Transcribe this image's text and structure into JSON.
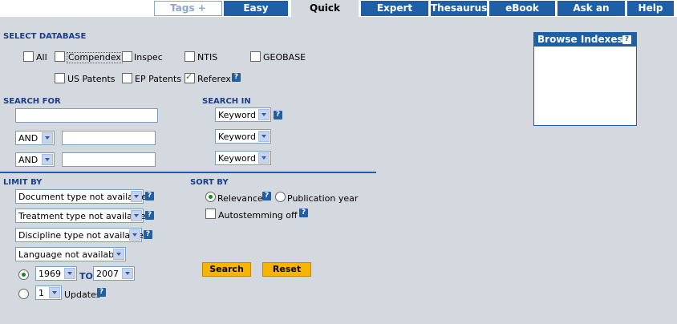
{
  "tabs": {
    "tags_groups": "Tags + Groups",
    "easy_search": "Easy Search",
    "quick_search": "Quick Search",
    "expert_search": "Expert Search",
    "thesaurus": "Thesaurus",
    "ebook_search": "eBook Search",
    "ask_expert": "Ask an Expert",
    "help": "Help"
  },
  "select_database": {
    "heading": "SELECT DATABASE",
    "options": {
      "all": {
        "label": "All",
        "checked": false
      },
      "compendex": {
        "label": "Compendex",
        "checked": false
      },
      "inspec": {
        "label": "Inspec",
        "checked": false
      },
      "ntis": {
        "label": "NTIS",
        "checked": false
      },
      "geobase": {
        "label": "GEOBASE",
        "checked": false
      },
      "us_patents": {
        "label": "US Patents",
        "checked": false
      },
      "ep_patents": {
        "label": "EP Patents",
        "checked": false
      },
      "referex": {
        "label": "Referex",
        "checked": true
      }
    }
  },
  "search_for": {
    "heading": "SEARCH FOR",
    "row1_value": "",
    "row2_operator": "AND",
    "row2_value": "",
    "row3_operator": "AND",
    "row3_value": ""
  },
  "search_in": {
    "heading": "SEARCH IN",
    "row1": "Keyword",
    "row2": "Keyword",
    "row3": "Keyword"
  },
  "limit_by": {
    "heading": "LIMIT BY",
    "document_type": "Document type not available",
    "treatment_type": "Treatment type not available",
    "discipline_type": "Discipline type not available",
    "language": "Language not available",
    "year_from": "1969",
    "to_label": "TO",
    "year_to": "2007",
    "updates_value": "1",
    "updates_label": "Updates",
    "date_range_selected": true
  },
  "sort_by": {
    "heading": "SORT BY",
    "relevance": "Relevance",
    "publication_year": "Publication year",
    "selected": "relevance",
    "autostemming_label": "Autostemming off",
    "autostemming_checked": false
  },
  "buttons": {
    "search": "Search",
    "reset": "Reset"
  },
  "browse_indexes": {
    "title": "Browse Indexes"
  },
  "icons": {
    "help": "?"
  },
  "colors": {
    "tab_blue": "#1f5fa6",
    "panel_bg": "#d4d8df",
    "heading_blue": "#1a3e8c",
    "button_gold": "#f7b500"
  }
}
